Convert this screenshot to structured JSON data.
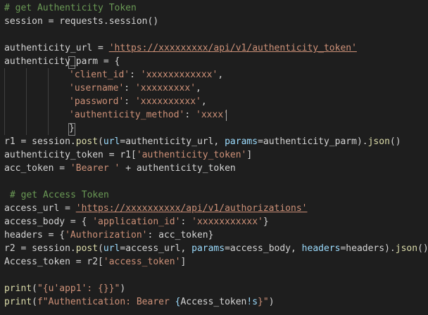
{
  "colors": {
    "background": "#1e1e1e",
    "default": "#d4d4d4",
    "comment": "#6a9955",
    "string": "#ce9178",
    "function": "#dcdcaa",
    "parameter": "#9cdcfe",
    "brace": "#d4d4d4"
  },
  "editor": {
    "lines": [
      [
        {
          "t": "# get Authenticity Token",
          "c": "comment"
        }
      ],
      [
        {
          "t": "session = requests.session()",
          "c": "default"
        }
      ],
      [],
      [
        {
          "t": "authenticity_url = ",
          "c": "default"
        },
        {
          "t": "'https://xxxxxxxxx/api/v1/authenticity_token'",
          "c": "string",
          "u": true
        }
      ],
      [
        {
          "t": "authenticity_parm = {",
          "c": "default"
        }
      ],
      [
        {
          "t": "'client_id'",
          "c": "string"
        },
        {
          "t": ": ",
          "c": "default"
        },
        {
          "t": "'xxxxxxxxxxxx'",
          "c": "string"
        },
        {
          "t": ",",
          "c": "default"
        }
      ],
      [
        {
          "t": "'username'",
          "c": "string"
        },
        {
          "t": ": ",
          "c": "default"
        },
        {
          "t": "'xxxxxxxxx'",
          "c": "string"
        },
        {
          "t": ",",
          "c": "default"
        }
      ],
      [
        {
          "t": "'password'",
          "c": "string"
        },
        {
          "t": ": ",
          "c": "default"
        },
        {
          "t": "'xxxxxxxxxx'",
          "c": "string"
        },
        {
          "t": ",",
          "c": "default"
        }
      ],
      [
        {
          "t": "'authenticity_method'",
          "c": "string"
        },
        {
          "t": ": ",
          "c": "default"
        },
        {
          "t": "'xxxx'",
          "c": "string"
        }
      ],
      [
        {
          "t": "}",
          "c": "default"
        }
      ],
      [
        {
          "t": "r1 = session.",
          "c": "default"
        },
        {
          "t": "post",
          "c": "function"
        },
        {
          "t": "(",
          "c": "default"
        },
        {
          "t": "url",
          "c": "parameter"
        },
        {
          "t": "=authenticity_url, ",
          "c": "default"
        },
        {
          "t": "params",
          "c": "parameter"
        },
        {
          "t": "=authenticity_parm).",
          "c": "default"
        },
        {
          "t": "json",
          "c": "function"
        },
        {
          "t": "()",
          "c": "default"
        }
      ],
      [
        {
          "t": "authenticity_token = r1[",
          "c": "default"
        },
        {
          "t": "'authenticity_token'",
          "c": "string"
        },
        {
          "t": "]",
          "c": "default"
        }
      ],
      [
        {
          "t": "acc_token = ",
          "c": "default"
        },
        {
          "t": "'Bearer '",
          "c": "string"
        },
        {
          "t": " + authenticity_token",
          "c": "default"
        }
      ],
      [],
      [
        {
          "t": "# get Access Token",
          "c": "comment"
        }
      ],
      [
        {
          "t": "access_url = ",
          "c": "default"
        },
        {
          "t": "'https://xxxxxxxxxx/api/v1/authorizations'",
          "c": "string",
          "u": true
        }
      ],
      [
        {
          "t": "access_body = { ",
          "c": "default"
        },
        {
          "t": "'application_id'",
          "c": "string"
        },
        {
          "t": ": ",
          "c": "default"
        },
        {
          "t": "'xxxxxxxxxxx'",
          "c": "string"
        },
        {
          "t": "}",
          "c": "default"
        }
      ],
      [
        {
          "t": "headers = {",
          "c": "default"
        },
        {
          "t": "'Authorization'",
          "c": "string"
        },
        {
          "t": ": acc_token}",
          "c": "default"
        }
      ],
      [
        {
          "t": "r2 = session.",
          "c": "default"
        },
        {
          "t": "post",
          "c": "function"
        },
        {
          "t": "(",
          "c": "default"
        },
        {
          "t": "url",
          "c": "parameter"
        },
        {
          "t": "=access_url, ",
          "c": "default"
        },
        {
          "t": "params",
          "c": "parameter"
        },
        {
          "t": "=access_body, ",
          "c": "default"
        },
        {
          "t": "headers",
          "c": "parameter"
        },
        {
          "t": "=headers).",
          "c": "default"
        },
        {
          "t": "json",
          "c": "function"
        },
        {
          "t": "()",
          "c": "default"
        }
      ],
      [
        {
          "t": "Access_token = r2[",
          "c": "default"
        },
        {
          "t": "'access_token'",
          "c": "string"
        },
        {
          "t": "]",
          "c": "default"
        }
      ],
      [],
      [
        {
          "t": "print",
          "c": "function"
        },
        {
          "t": "(",
          "c": "default"
        },
        {
          "t": "\"{u'app1': {}}\"",
          "c": "string"
        },
        {
          "t": ")",
          "c": "default"
        }
      ],
      [
        {
          "t": "print",
          "c": "function"
        },
        {
          "t": "(",
          "c": "default"
        },
        {
          "t": "f\"Authentication: Bearer ",
          "c": "string"
        },
        {
          "t": "{",
          "c": "parameter"
        },
        {
          "t": "Access_token",
          "c": "default"
        },
        {
          "t": "!s",
          "c": "parameter"
        },
        {
          "t": "}\"",
          "c": "string"
        },
        {
          "t": ")",
          "c": "default"
        }
      ]
    ]
  }
}
